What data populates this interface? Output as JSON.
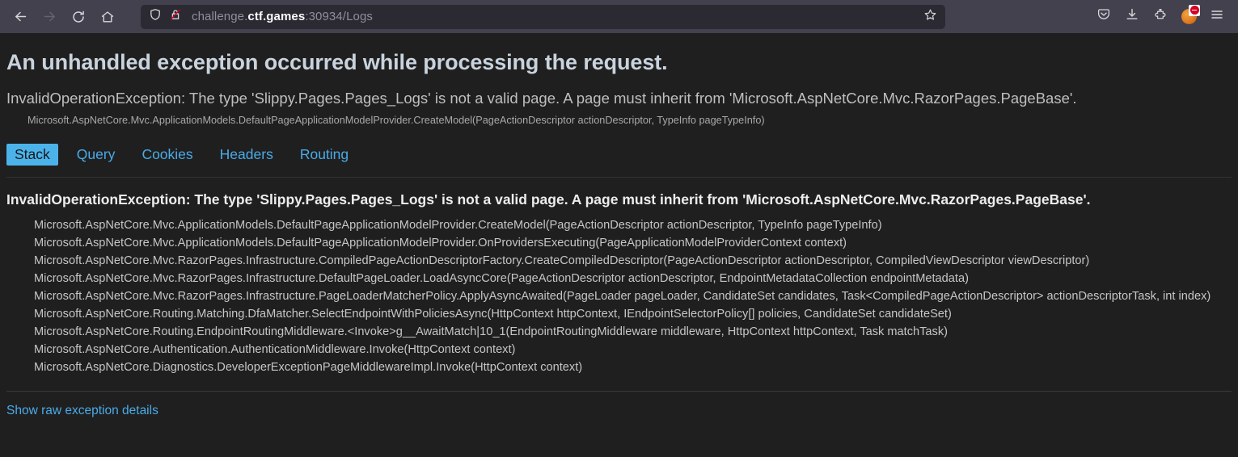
{
  "browser": {
    "back_label": "Back",
    "forward_label": "Forward",
    "reload_label": "Reload",
    "home_label": "Home",
    "url_prefix": "challenge.",
    "url_host": "ctf.games",
    "url_suffix": ":30934/Logs",
    "bookmark_label": "Bookmark this page",
    "shield_label": "Tracking protection",
    "lock_label": "Connection is not secure",
    "pocket_label": "Save to Pocket",
    "downloads_label": "Downloads",
    "extensions_label": "Extensions",
    "blocker_label": "uBlock Origin",
    "menu_label": "Open application menu"
  },
  "page": {
    "title": "An unhandled exception occurred while processing the request.",
    "subtitle": "InvalidOperationException: The type 'Slippy.Pages.Pages_Logs' is not a valid page. A page must inherit from 'Microsoft.AspNetCore.Mvc.RazorPages.PageBase'.",
    "sub_stack": "Microsoft.AspNetCore.Mvc.ApplicationModels.DefaultPageApplicationModelProvider.CreateModel(PageActionDescriptor actionDescriptor, TypeInfo pageTypeInfo)",
    "tabs": [
      {
        "label": "Stack",
        "active": true
      },
      {
        "label": "Query",
        "active": false
      },
      {
        "label": "Cookies",
        "active": false
      },
      {
        "label": "Headers",
        "active": false
      },
      {
        "label": "Routing",
        "active": false
      }
    ],
    "stack_heading": "InvalidOperationException: The type 'Slippy.Pages.Pages_Logs' is not a valid page. A page must inherit from 'Microsoft.AspNetCore.Mvc.RazorPages.PageBase'.",
    "stack_lines": [
      "Microsoft.AspNetCore.Mvc.ApplicationModels.DefaultPageApplicationModelProvider.CreateModel(PageActionDescriptor actionDescriptor, TypeInfo pageTypeInfo)",
      "Microsoft.AspNetCore.Mvc.ApplicationModels.DefaultPageApplicationModelProvider.OnProvidersExecuting(PageApplicationModelProviderContext context)",
      "Microsoft.AspNetCore.Mvc.RazorPages.Infrastructure.CompiledPageActionDescriptorFactory.CreateCompiledDescriptor(PageActionDescriptor actionDescriptor, CompiledViewDescriptor viewDescriptor)",
      "Microsoft.AspNetCore.Mvc.RazorPages.Infrastructure.DefaultPageLoader.LoadAsyncCore(PageActionDescriptor actionDescriptor, EndpointMetadataCollection endpointMetadata)",
      "Microsoft.AspNetCore.Mvc.RazorPages.Infrastructure.PageLoaderMatcherPolicy.ApplyAsyncAwaited(PageLoader pageLoader, CandidateSet candidates, Task<CompiledPageActionDescriptor> actionDescriptorTask, int index)",
      "Microsoft.AspNetCore.Routing.Matching.DfaMatcher.SelectEndpointWithPoliciesAsync(HttpContext httpContext, IEndpointSelectorPolicy[] policies, CandidateSet candidateSet)",
      "Microsoft.AspNetCore.Routing.EndpointRoutingMiddleware.<Invoke>g__AwaitMatch|10_1(EndpointRoutingMiddleware middleware, HttpContext httpContext, Task matchTask)",
      "Microsoft.AspNetCore.Authentication.AuthenticationMiddleware.Invoke(HttpContext context)",
      "Microsoft.AspNetCore.Diagnostics.DeveloperExceptionPageMiddlewareImpl.Invoke(HttpContext context)"
    ],
    "raw_link": "Show raw exception details"
  },
  "colors": {
    "accent": "#4cb3ea",
    "link": "#4aabe8",
    "page_bg": "#1f1f1f",
    "chrome_bg": "#42414d",
    "urlbar_bg": "#2b2a33",
    "heading": "#c9d3dd",
    "badge_red": "#d70022"
  }
}
